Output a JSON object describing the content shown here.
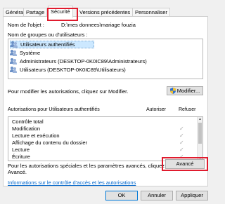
{
  "tabs": [
    "Général",
    "Partage",
    "Sécurité",
    "Versions précédentes",
    "Personnaliser"
  ],
  "object_name": {
    "label": "Nom de l'objet :",
    "value": "D:\\mes donnees\\mariage fouzia"
  },
  "groups_label": "Nom de groupes ou d'utilisateurs :",
  "users": [
    {
      "name": "Utilisateurs authentifiés",
      "selected": true
    },
    {
      "name": "Système",
      "selected": false
    },
    {
      "name": "Administrateurs (DESKTOP-0K0IC89\\Administrateurs)",
      "selected": false
    },
    {
      "name": "Utilisateurs (DESKTOP-0K0IC89\\Utilisateurs)",
      "selected": false
    }
  ],
  "modify_hint": "Pour modifier les autorisations, cliquez sur Modifier.",
  "modify_button": "Modifier...",
  "perms_header": {
    "label": "Autorisations pour Utilisateurs authentifiés",
    "allow": "Autoriser",
    "deny": "Refuser"
  },
  "permissions": [
    {
      "name": "Contrôle total",
      "allow": ""
    },
    {
      "name": "Modification",
      "allow": "✓"
    },
    {
      "name": "Lecture et exécution",
      "allow": "✓"
    },
    {
      "name": "Affichage du contenu du dossier",
      "allow": "✓"
    },
    {
      "name": "Lecture",
      "allow": "✓"
    },
    {
      "name": "Écriture",
      "allow": "✓"
    }
  ],
  "advanced_hint_1": "Pour les autorisations spéciales et les paramètres avancés, cliquez sur",
  "advanced_hint_2": "Avancé.",
  "advanced_button": "Avancé",
  "info_link": "Informations sur le contrôle d'accès et les autorisations",
  "footer_buttons": {
    "ok": "OK",
    "cancel": "Annuler",
    "apply": "Appliquer"
  },
  "colors": {
    "highlight": "#e01b2e",
    "selection": "#cce8ff",
    "link": "#0066cc"
  }
}
